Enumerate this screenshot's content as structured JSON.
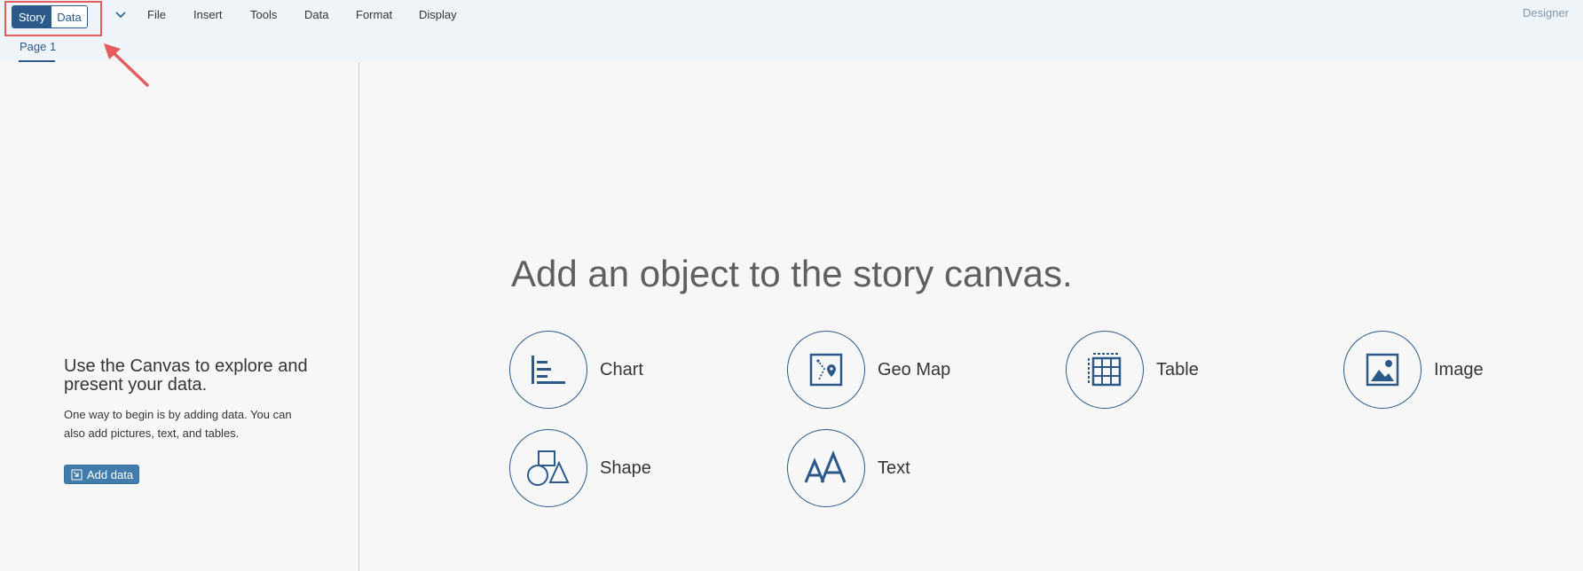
{
  "toolbar": {
    "story_toggle": "Story",
    "data_toggle": "Data",
    "menus": [
      "File",
      "Insert",
      "Tools",
      "Data",
      "Format",
      "Display"
    ],
    "mode_label": "Designer"
  },
  "tabs": [
    {
      "label": "Page 1",
      "active": true
    }
  ],
  "left_panel": {
    "title": "Use the Canvas to explore and present your data.",
    "description": "One way to begin is by adding data. You can also add pictures, text, and tables.",
    "add_data_label": "Add data"
  },
  "canvas": {
    "title": "Add an object to the story canvas.",
    "objects": [
      {
        "label": "Chart",
        "icon": "chart-icon"
      },
      {
        "label": "Geo Map",
        "icon": "geo-map-icon"
      },
      {
        "label": "Table",
        "icon": "table-icon"
      },
      {
        "label": "Image",
        "icon": "image-icon"
      },
      {
        "label": "Shape",
        "icon": "shape-icon"
      },
      {
        "label": "Text",
        "icon": "text-icon"
      }
    ]
  },
  "colors": {
    "accent": "#2b5a8a",
    "button": "#427cac",
    "annotation": "#e35d5d",
    "shell_bg": "#eff4f9"
  }
}
